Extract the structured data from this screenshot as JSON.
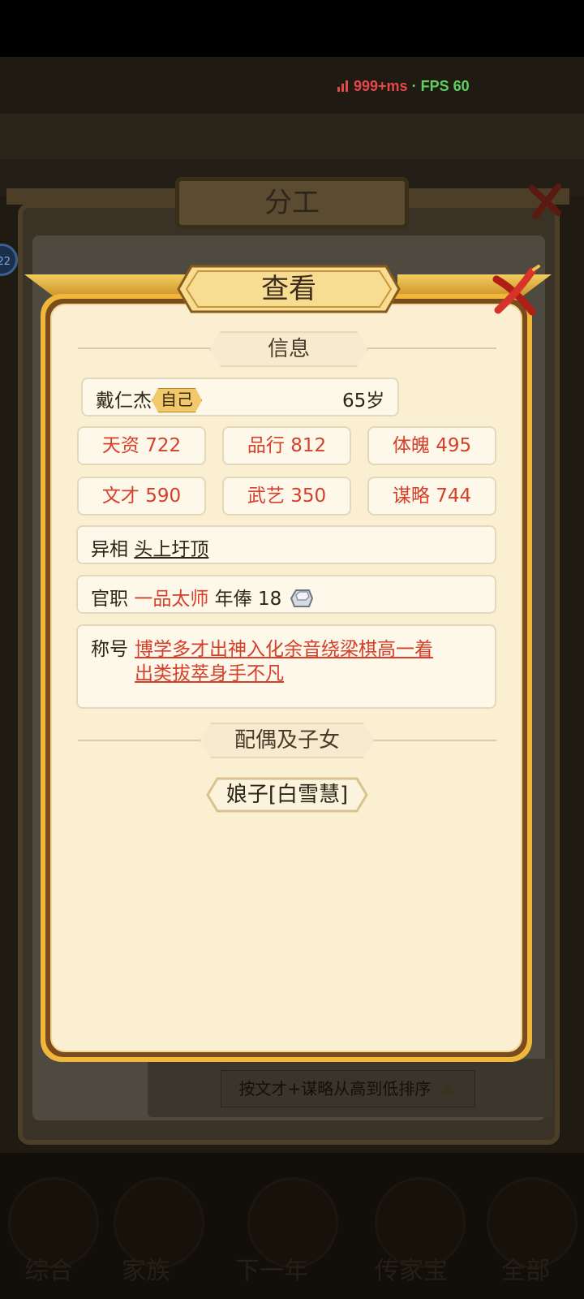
{
  "status": {
    "latency": "999+ms",
    "separator": "·",
    "fps": "FPS 60"
  },
  "background": {
    "panel_title": "分工",
    "sort_button": "按文才+谋略从高到低排序",
    "nav": [
      "综合",
      "家族",
      "下一年",
      "传家宝",
      "全部"
    ],
    "badge": "22"
  },
  "modal": {
    "title": "查看",
    "info_header": "信息",
    "person": {
      "name": "戴仁杰",
      "tag": "自己",
      "age": "65岁"
    },
    "stats": [
      {
        "label": "天资 722"
      },
      {
        "label": "品行 812"
      },
      {
        "label": "体魄 495"
      },
      {
        "label": "文才 590"
      },
      {
        "label": "武艺 350"
      },
      {
        "label": "谋略 744"
      }
    ],
    "trait": {
      "label": "异相",
      "value": "头上圩顶"
    },
    "office": {
      "label": "官职",
      "value": "一品太师",
      "salary_label": "年俸",
      "salary": "18",
      "salary_icon": "silver-ingot-icon"
    },
    "titles": {
      "label": "称号",
      "line1": "博学多才出神入化余音绕梁棋高一着",
      "line2": "出类拔萃身手不凡"
    },
    "family_header": "配偶及子女",
    "spouse": "娘子[白雪慧]"
  },
  "colors": {
    "accent_red": "#d4402b",
    "gold": "#f0b73a",
    "paper": "#faefd0"
  }
}
